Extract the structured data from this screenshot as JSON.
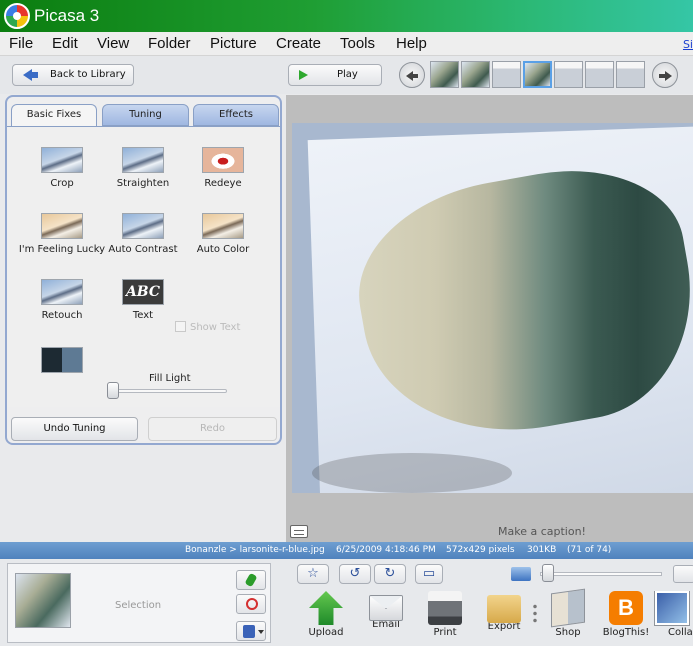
{
  "app": {
    "title": "Picasa 3"
  },
  "menu": {
    "items": [
      "File",
      "Edit",
      "View",
      "Folder",
      "Picture",
      "Create",
      "Tools",
      "Help"
    ],
    "sign_in": "Si"
  },
  "toolbar": {
    "back_label": "Back to Library",
    "play_label": "Play"
  },
  "left_panel": {
    "tabs": [
      "Basic Fixes",
      "Tuning",
      "Effects"
    ],
    "active_tab": "Basic Fixes",
    "tools": [
      "Crop",
      "Straighten",
      "Redeye",
      "I'm Feeling Lucky",
      "Auto Contrast",
      "Auto Color",
      "Retouch",
      "Text"
    ],
    "text_icon_label": "ABC",
    "show_text_label": "Show Text",
    "fill_light_label": "Fill Light",
    "fill_light_value": 0,
    "undo_label": "Undo Tuning",
    "redo_label": "Redo"
  },
  "photo": {
    "caption_placeholder": "Make a caption!"
  },
  "status": {
    "path": "Bonanzle > larsonite-r-blue.jpg",
    "datetime": "6/25/2009 4:18:46 PM",
    "dimensions": "572x429 pixels",
    "size": "301KB",
    "position": "(71 of 74)"
  },
  "tray": {
    "selection_label": "Selection"
  },
  "actions": [
    "Upload",
    "Email",
    "Print",
    "Export",
    "Shop",
    "BlogThis!",
    "Collage"
  ],
  "blog_icon_letter": "B",
  "colors": {
    "title_gradient_start": "#0b7d0f",
    "title_gradient_end": "#35c6a6",
    "status_bar": "#5a8cc6",
    "tab_active_border": "#8aa0c6"
  }
}
